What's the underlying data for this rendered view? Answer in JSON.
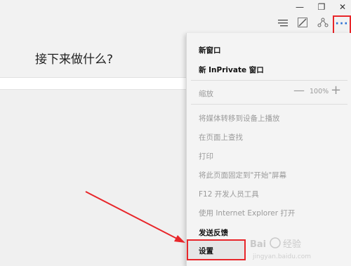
{
  "window": {
    "minimize_glyph": "—",
    "maximize_glyph": "❐",
    "close_glyph": "✕"
  },
  "toolbar": {
    "hub_icon": "hub-icon",
    "web_note_icon": "web-note-icon",
    "share_icon": "share-icon",
    "more_label": "···"
  },
  "new_tab": {
    "title": "接下来做什么?"
  },
  "menu": {
    "new_window": "新窗口",
    "new_inprivate": "新 InPrivate 窗口",
    "zoom_label": "缩放",
    "zoom_minus": "—",
    "zoom_value": "100%",
    "zoom_plus": "+",
    "cast_media": "将媒体转移到设备上播放",
    "find_on_page": "在页面上查找",
    "print": "打印",
    "pin_to_start": "将此页面固定到\"开始\"屏幕",
    "f12_tools": "F12 开发人员工具",
    "open_with_ie": "使用 Internet Explorer 打开",
    "send_feedback": "发送反馈",
    "settings": "设置"
  },
  "annotation": {
    "highlight_color": "#e8262a"
  },
  "watermark": {
    "text": "Bai 经验",
    "url": "jingyan.baidu.com"
  }
}
